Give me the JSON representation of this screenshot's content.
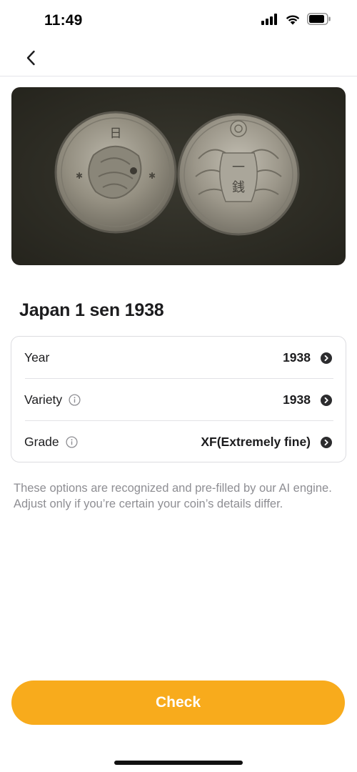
{
  "status_bar": {
    "time": "11:49",
    "icons": [
      "cellular-signal-icon",
      "wifi-icon",
      "battery-icon"
    ]
  },
  "nav": {
    "back_icon": "chevron-left-icon"
  },
  "coin_photo": {
    "description_alt": "Japan 1 sen 1938 obverse and reverse"
  },
  "coin": {
    "title": "Japan 1 sen 1938"
  },
  "details": [
    {
      "label": "Year",
      "value": "1938",
      "info_icon": false
    },
    {
      "label": "Variety",
      "value": "1938",
      "info_icon": true
    },
    {
      "label": "Grade",
      "value": "XF(Extremely fine)",
      "info_icon": true
    }
  ],
  "helper_text": "These options are recognized and pre-filled by our AI engine. Adjust only if you’re certain your coin’s details differ.",
  "check_button": {
    "label": "Check",
    "color": "#f8ab1c"
  }
}
